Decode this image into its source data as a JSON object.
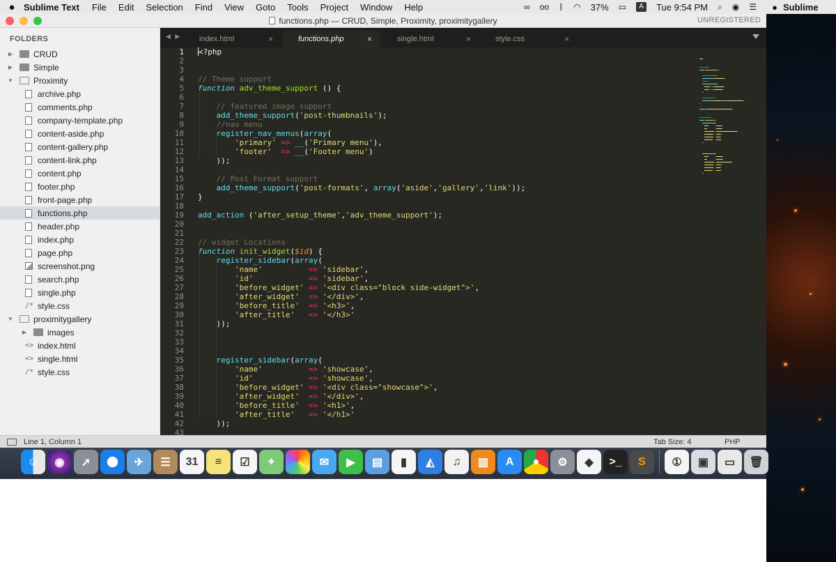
{
  "menubar": {
    "app_name": "Sublime Text",
    "items": [
      "File",
      "Edit",
      "Selection",
      "Find",
      "View",
      "Goto",
      "Tools",
      "Project",
      "Window",
      "Help"
    ],
    "battery": "37%",
    "input_badge": "A",
    "clock": "Tue 9:54 PM"
  },
  "desktop": {
    "partial_app_name": "Sublime"
  },
  "window": {
    "title": "functions.php — CRUD, Simple, Proximity, proximitygallery",
    "license": "UNREGISTERED"
  },
  "sidebar": {
    "heading": "FOLDERS",
    "rows": [
      {
        "label": "CRUD",
        "kind": "folder",
        "depth": 0,
        "expanded": false
      },
      {
        "label": "Simple",
        "kind": "folder",
        "depth": 0,
        "expanded": false
      },
      {
        "label": "Proximity",
        "kind": "folder",
        "depth": 0,
        "expanded": true
      },
      {
        "label": "archive.php",
        "kind": "file",
        "depth": 1
      },
      {
        "label": "comments.php",
        "kind": "file",
        "depth": 1
      },
      {
        "label": "company-template.php",
        "kind": "file",
        "depth": 1
      },
      {
        "label": "content-aside.php",
        "kind": "file",
        "depth": 1
      },
      {
        "label": "content-gallery.php",
        "kind": "file",
        "depth": 1
      },
      {
        "label": "content-link.php",
        "kind": "file",
        "depth": 1
      },
      {
        "label": "content.php",
        "kind": "file",
        "depth": 1
      },
      {
        "label": "footer.php",
        "kind": "file",
        "depth": 1
      },
      {
        "label": "front-page.php",
        "kind": "file",
        "depth": 1
      },
      {
        "label": "functions.php",
        "kind": "file",
        "depth": 1,
        "selected": true
      },
      {
        "label": "header.php",
        "kind": "file",
        "depth": 1
      },
      {
        "label": "index.php",
        "kind": "file",
        "depth": 1
      },
      {
        "label": "page.php",
        "kind": "file",
        "depth": 1
      },
      {
        "label": "screenshot.png",
        "kind": "image",
        "depth": 1
      },
      {
        "label": "search.php",
        "kind": "file",
        "depth": 1
      },
      {
        "label": "single.php",
        "kind": "file",
        "depth": 1
      },
      {
        "label": "style.css",
        "kind": "css",
        "depth": 1
      },
      {
        "label": "proximitygallery",
        "kind": "folder",
        "depth": 0,
        "expanded": true
      },
      {
        "label": "images",
        "kind": "folder",
        "depth": 1,
        "expanded": false
      },
      {
        "label": "index.html",
        "kind": "html",
        "depth": 1
      },
      {
        "label": "single.html",
        "kind": "html",
        "depth": 1
      },
      {
        "label": "style.css",
        "kind": "css",
        "depth": 1
      }
    ]
  },
  "tabs": [
    {
      "label": "index.html",
      "active": false
    },
    {
      "label": "functions.php",
      "active": true
    },
    {
      "label": "single.html",
      "active": false
    },
    {
      "label": "style.css",
      "active": false
    }
  ],
  "tab_close_glyph": "×",
  "editor": {
    "lines": [
      [
        [
          "php",
          "<?php"
        ]
      ],
      [],
      [],
      [
        [
          "cmt",
          "// Theme support"
        ]
      ],
      [
        [
          "kw",
          "function"
        ],
        [
          "t",
          " "
        ],
        [
          "fn",
          "adv_theme_support"
        ],
        [
          "t",
          " () {"
        ]
      ],
      [],
      [
        [
          "t",
          "    "
        ],
        [
          "cmt",
          "// featured image support"
        ]
      ],
      [
        [
          "t",
          "    "
        ],
        [
          "call",
          "add_theme_support"
        ],
        [
          "t",
          "("
        ],
        [
          "str",
          "'post-thumbnails'"
        ],
        [
          "t",
          ");"
        ]
      ],
      [
        [
          "t",
          "    "
        ],
        [
          "cmt",
          "//nav menu"
        ]
      ],
      [
        [
          "t",
          "    "
        ],
        [
          "call",
          "register_nav_menus"
        ],
        [
          "t",
          "("
        ],
        [
          "call",
          "array"
        ],
        [
          "t",
          "("
        ]
      ],
      [
        [
          "t",
          "        "
        ],
        [
          "str",
          "'primary'"
        ],
        [
          "t",
          " "
        ],
        [
          "op",
          "=>"
        ],
        [
          "t",
          " "
        ],
        [
          "call",
          "__"
        ],
        [
          "t",
          "("
        ],
        [
          "str",
          "'Primary menu'"
        ],
        [
          "t",
          "),"
        ]
      ],
      [
        [
          "t",
          "        "
        ],
        [
          "str",
          "'footer'"
        ],
        [
          "t",
          "  "
        ],
        [
          "op",
          "=>"
        ],
        [
          "t",
          " "
        ],
        [
          "call",
          "__"
        ],
        [
          "t",
          "("
        ],
        [
          "str",
          "'Footer menu'"
        ],
        [
          "t",
          ")"
        ]
      ],
      [
        [
          "t",
          "    "
        ],
        [
          "t",
          "));"
        ]
      ],
      [],
      [
        [
          "t",
          "    "
        ],
        [
          "cmt",
          "// Post Format support"
        ]
      ],
      [
        [
          "t",
          "    "
        ],
        [
          "call",
          "add_theme_support"
        ],
        [
          "t",
          "("
        ],
        [
          "str",
          "'post-formats'"
        ],
        [
          "t",
          ", "
        ],
        [
          "call",
          "array"
        ],
        [
          "t",
          "("
        ],
        [
          "str",
          "'aside'"
        ],
        [
          "t",
          ","
        ],
        [
          "str",
          "'gallery'"
        ],
        [
          "t",
          ","
        ],
        [
          "str",
          "'link'"
        ],
        [
          "t",
          "));"
        ]
      ],
      [
        [
          "t",
          "}"
        ]
      ],
      [],
      [
        [
          "call",
          "add_action"
        ],
        [
          "t",
          " ("
        ],
        [
          "str",
          "'after_setup_theme'"
        ],
        [
          "t",
          ","
        ],
        [
          "str",
          "'adv_theme_support'"
        ],
        [
          "t",
          ");"
        ]
      ],
      [],
      [],
      [
        [
          "cmt",
          "// widget Locations"
        ]
      ],
      [
        [
          "kw",
          "function"
        ],
        [
          "t",
          " "
        ],
        [
          "fn",
          "init_widget"
        ],
        [
          "t",
          "("
        ],
        [
          "var",
          "$id"
        ],
        [
          "t",
          ") {"
        ]
      ],
      [
        [
          "t",
          "    "
        ],
        [
          "call",
          "register_sidebar"
        ],
        [
          "t",
          "("
        ],
        [
          "call",
          "array"
        ],
        [
          "t",
          "("
        ]
      ],
      [
        [
          "t",
          "        "
        ],
        [
          "str",
          "'name'"
        ],
        [
          "t",
          "          "
        ],
        [
          "op",
          "=>"
        ],
        [
          "t",
          " "
        ],
        [
          "str",
          "'sidebar'"
        ],
        [
          "t",
          ","
        ]
      ],
      [
        [
          "t",
          "        "
        ],
        [
          "str",
          "'id'"
        ],
        [
          "t",
          "            "
        ],
        [
          "op",
          "=>"
        ],
        [
          "t",
          " "
        ],
        [
          "str",
          "'sidebar'"
        ],
        [
          "t",
          ","
        ]
      ],
      [
        [
          "t",
          "        "
        ],
        [
          "str",
          "'before_widget'"
        ],
        [
          "t",
          " "
        ],
        [
          "op",
          "=>"
        ],
        [
          "t",
          " "
        ],
        [
          "str",
          "'<div class=\"block side-widget\">'"
        ],
        [
          "t",
          ","
        ]
      ],
      [
        [
          "t",
          "        "
        ],
        [
          "str",
          "'after_widget'"
        ],
        [
          "t",
          "  "
        ],
        [
          "op",
          "=>"
        ],
        [
          "t",
          " "
        ],
        [
          "str",
          "'</div>'"
        ],
        [
          "t",
          ","
        ]
      ],
      [
        [
          "t",
          "        "
        ],
        [
          "str",
          "'before_title'"
        ],
        [
          "t",
          "  "
        ],
        [
          "op",
          "=>"
        ],
        [
          "t",
          " "
        ],
        [
          "str",
          "'<h3>'"
        ],
        [
          "t",
          ","
        ]
      ],
      [
        [
          "t",
          "        "
        ],
        [
          "str",
          "'after_title'"
        ],
        [
          "t",
          "   "
        ],
        [
          "op",
          "=>"
        ],
        [
          "t",
          " "
        ],
        [
          "str",
          "'</h3>'"
        ]
      ],
      [
        [
          "t",
          "    "
        ],
        [
          "t",
          "));"
        ]
      ],
      [],
      [],
      [],
      [
        [
          "t",
          "    "
        ],
        [
          "call",
          "register_sidebar"
        ],
        [
          "t",
          "("
        ],
        [
          "call",
          "array"
        ],
        [
          "t",
          "("
        ]
      ],
      [
        [
          "t",
          "        "
        ],
        [
          "str",
          "'name'"
        ],
        [
          "t",
          "          "
        ],
        [
          "op",
          "=>"
        ],
        [
          "t",
          " "
        ],
        [
          "str",
          "'showcase'"
        ],
        [
          "t",
          ","
        ]
      ],
      [
        [
          "t",
          "        "
        ],
        [
          "str",
          "'id'"
        ],
        [
          "t",
          "            "
        ],
        [
          "op",
          "=>"
        ],
        [
          "t",
          " "
        ],
        [
          "str",
          "'showcase'"
        ],
        [
          "t",
          ","
        ]
      ],
      [
        [
          "t",
          "        "
        ],
        [
          "str",
          "'before_widget'"
        ],
        [
          "t",
          " "
        ],
        [
          "op",
          "=>"
        ],
        [
          "t",
          " "
        ],
        [
          "str",
          "'<div class=\"showcase\">'"
        ],
        [
          "t",
          ","
        ]
      ],
      [
        [
          "t",
          "        "
        ],
        [
          "str",
          "'after_widget'"
        ],
        [
          "t",
          "  "
        ],
        [
          "op",
          "=>"
        ],
        [
          "t",
          " "
        ],
        [
          "str",
          "'</div>'"
        ],
        [
          "t",
          ","
        ]
      ],
      [
        [
          "t",
          "        "
        ],
        [
          "str",
          "'before_title'"
        ],
        [
          "t",
          "  "
        ],
        [
          "op",
          "=>"
        ],
        [
          "t",
          " "
        ],
        [
          "str",
          "'<h1>'"
        ],
        [
          "t",
          ","
        ]
      ],
      [
        [
          "t",
          "        "
        ],
        [
          "str",
          "'after_title'"
        ],
        [
          "t",
          "   "
        ],
        [
          "op",
          "=>"
        ],
        [
          "t",
          " "
        ],
        [
          "str",
          "'</h1>'"
        ]
      ],
      [
        [
          "t",
          "    "
        ],
        [
          "t",
          "));"
        ]
      ],
      []
    ],
    "current_line": 1
  },
  "statusbar": {
    "position": "Line 1, Column 1",
    "tab_size": "Tab Size: 4",
    "syntax": "PHP"
  },
  "colors": {
    "keyword": "#66d9ef",
    "function_name": "#a6e22e",
    "string": "#e6db74",
    "comment": "#75715e",
    "operator": "#f92672",
    "variable": "#fd971f",
    "editor_bg": "#272822"
  },
  "dock": {
    "items": [
      {
        "name": "finder-icon",
        "bg": "linear-gradient(90deg,#1a8cf0 50%,#e8e8e8 50%)",
        "glyph": "☺",
        "running": true
      },
      {
        "name": "siri-icon",
        "bg": "radial-gradient(circle,#c23bd4,#1a1a5a)",
        "glyph": "◉",
        "running": false
      },
      {
        "name": "launchpad-icon",
        "bg": "#8a8f99",
        "glyph": "➚",
        "running": false
      },
      {
        "name": "safari-icon",
        "bg": "radial-gradient(circle,#fff 30%,#1a7fe8 32%)",
        "glyph": "✦",
        "running": false
      },
      {
        "name": "mail-icon",
        "bg": "#6aa4d9",
        "glyph": "✈",
        "running": false
      },
      {
        "name": "contacts-icon",
        "bg": "#b08a5a",
        "glyph": "☰",
        "running": false
      },
      {
        "name": "calendar-icon",
        "bg": "#f5f5f5",
        "glyph": "31",
        "running": false,
        "dark": true
      },
      {
        "name": "notes-icon",
        "bg": "#f7e27a",
        "glyph": "≡",
        "running": false,
        "dark": true
      },
      {
        "name": "reminders-icon",
        "bg": "#f5f5f5",
        "glyph": "☑",
        "running": false,
        "dark": true
      },
      {
        "name": "maps-icon",
        "bg": "#7ec97a",
        "glyph": "⌖",
        "running": false
      },
      {
        "name": "photos-icon",
        "bg": "conic-gradient(#f44,#fa0,#fe4,#5c5,#4ae,#a5e,#f44)",
        "glyph": "",
        "running": false
      },
      {
        "name": "messages-icon",
        "bg": "#4aa8f0",
        "glyph": "✉",
        "running": false
      },
      {
        "name": "facetime-icon",
        "bg": "#3dbf4a",
        "glyph": "▶",
        "running": false
      },
      {
        "name": "keynote-preview-icon",
        "bg": "#5aa0e0",
        "glyph": "▤",
        "running": false
      },
      {
        "name": "numbers-icon",
        "bg": "#f5f5f5",
        "glyph": "▮",
        "running": false,
        "dark": true
      },
      {
        "name": "keynote-icon",
        "bg": "#2f7ee6",
        "glyph": "◭",
        "running": false
      },
      {
        "name": "music-icon",
        "bg": "#f2f2f2",
        "glyph": "♫",
        "running": false,
        "dark": true
      },
      {
        "name": "ibooks-icon",
        "bg": "#f08a1e",
        "glyph": "▥",
        "running": false
      },
      {
        "name": "app-store-icon",
        "bg": "#2a8cf0",
        "glyph": "A",
        "running": false
      },
      {
        "name": "chrome-icon",
        "bg": "conic-gradient(#e33 0 33%,#fc0 0 66%,#2a4 0)",
        "glyph": "●",
        "running": true
      },
      {
        "name": "system-preferences-icon",
        "bg": "#8c8f96",
        "glyph": "⚙",
        "running": false
      },
      {
        "name": "unity-icon",
        "bg": "#f5f5f5",
        "glyph": "◆",
        "running": false,
        "dark": true
      },
      {
        "name": "terminal-icon",
        "bg": "#222",
        "glyph": ">_",
        "running": false
      },
      {
        "name": "sublime-text-icon",
        "bg": "#4a4a4a",
        "glyph": "S",
        "running": true,
        "accent": "#ff9800"
      },
      {
        "sep": true
      },
      {
        "name": "onepassword-icon",
        "bg": "#f5f5f5",
        "glyph": "①",
        "running": false,
        "dark": true
      },
      {
        "name": "preview-icon",
        "bg": "#d8dde3",
        "glyph": "▣",
        "running": false,
        "dark": true
      },
      {
        "name": "downloads-icon",
        "bg": "#e8e8e8",
        "glyph": "▭",
        "running": false,
        "dark": true
      },
      {
        "name": "trash-icon",
        "bg": "#cfd3d8",
        "glyph": "🗑",
        "running": false,
        "dark": true
      }
    ]
  }
}
